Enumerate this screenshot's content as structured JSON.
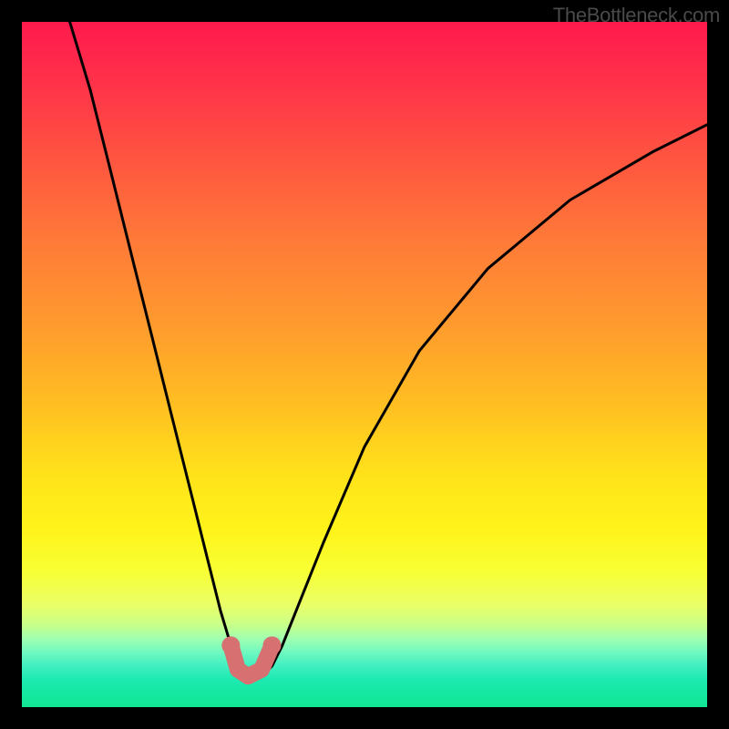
{
  "watermark": "TheBottleneck.com",
  "chart_data": {
    "type": "line",
    "title": "",
    "xlabel": "",
    "ylabel": "",
    "xlim": [
      0,
      100
    ],
    "ylim": [
      0,
      100
    ],
    "series": [
      {
        "name": "bottleneck-curve",
        "x": [
          7,
          10,
          13,
          16,
          19,
          22,
          25,
          27,
          29,
          30.5,
          32,
          33.5,
          35,
          36.5,
          38,
          40,
          44,
          50,
          58,
          68,
          80,
          92,
          100
        ],
        "y": [
          100,
          90,
          78,
          66,
          54,
          42,
          30,
          22,
          14,
          9,
          6,
          4.5,
          4.5,
          6,
          9,
          14,
          24,
          38,
          52,
          64,
          74,
          81,
          85
        ]
      }
    ],
    "markers": [
      {
        "name": "left-dot",
        "x": 30.5,
        "y": 9
      },
      {
        "name": "right-dot",
        "x": 36.5,
        "y": 9
      }
    ],
    "valley_segment": {
      "name": "bottom-stroke",
      "x": [
        30.5,
        31.5,
        33,
        35,
        36.5
      ],
      "y": [
        9,
        5.5,
        4.5,
        5.5,
        9
      ]
    },
    "gradient_note": "vertical red→orange→yellow→green background"
  }
}
